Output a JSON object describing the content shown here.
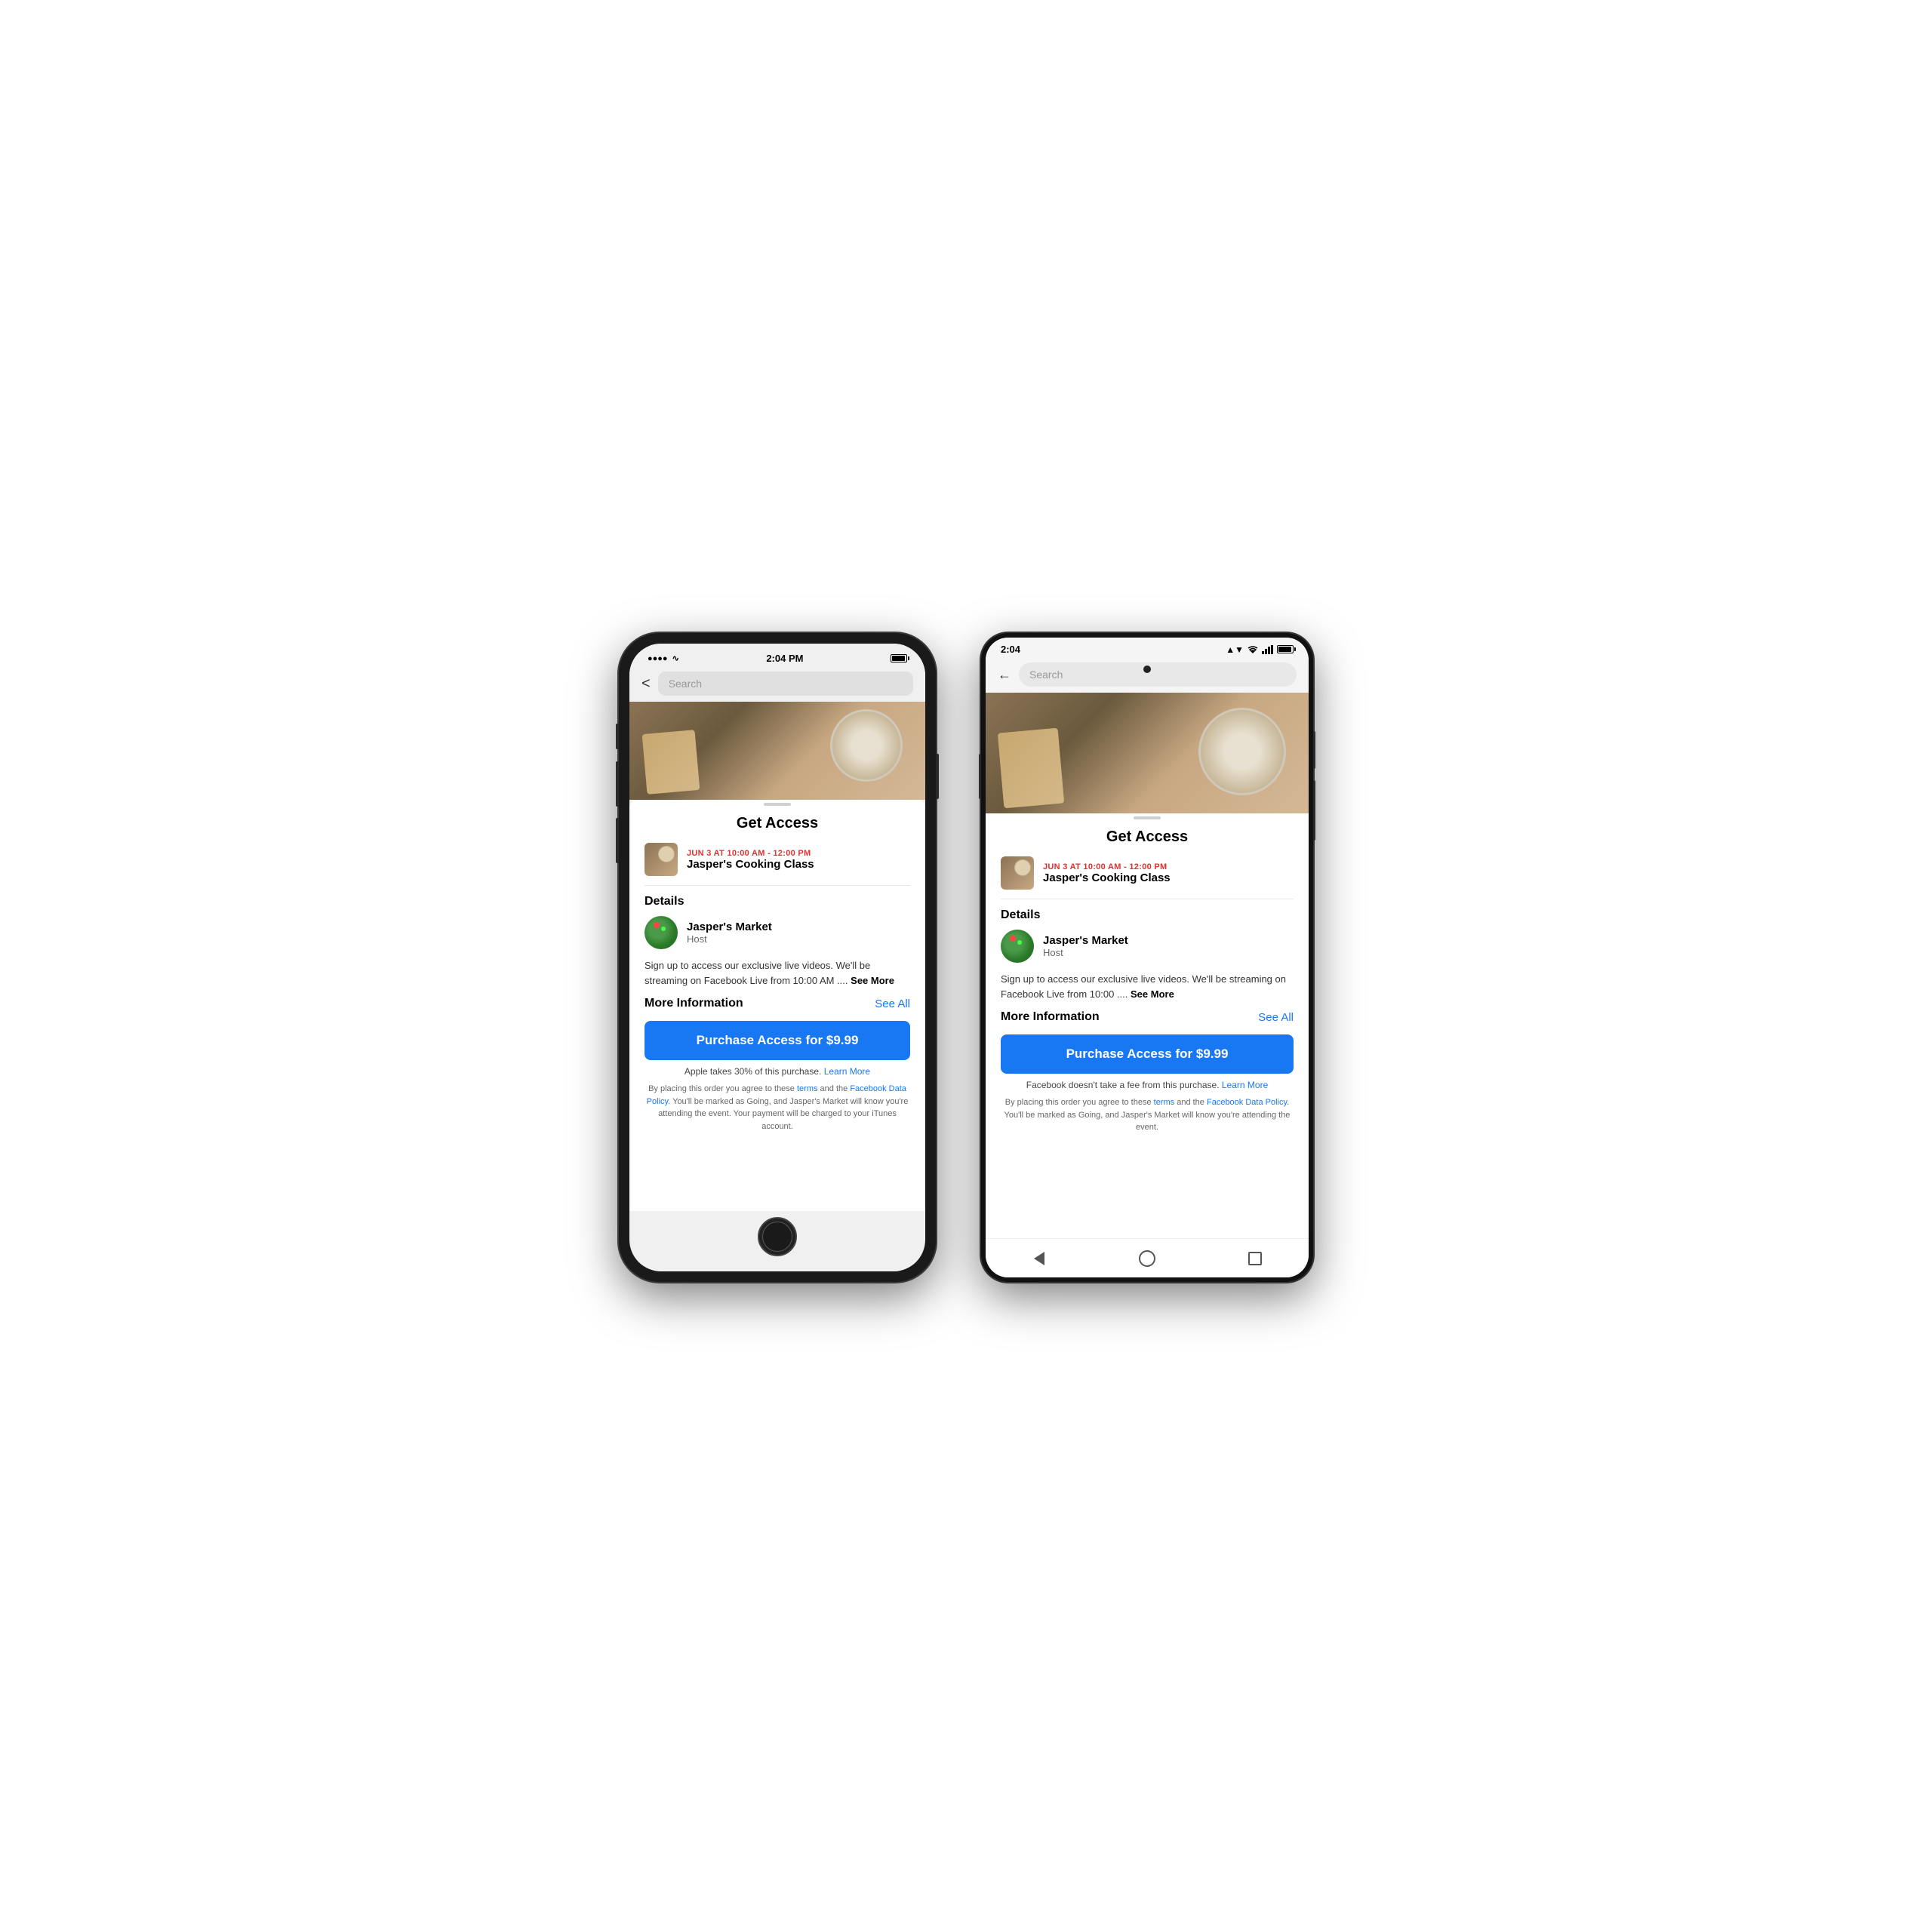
{
  "page": {
    "background": "#ffffff"
  },
  "iphone": {
    "status": {
      "signal": "●●●●",
      "wifi": "WiFi",
      "time": "2:04 PM",
      "battery": "full"
    },
    "search": {
      "back_label": "<",
      "placeholder": "Search"
    },
    "sheet": {
      "title": "Get Access",
      "event_date": "JUN 3 AT 10:00 AM - 12:00 PM",
      "event_name": "Jasper's Cooking Class",
      "details_label": "Details",
      "host_name": "Jasper's Market",
      "host_role": "Host",
      "description": "Sign up to access our exclusive live videos. We'll be streaming on Facebook Live from 10:00 AM ....",
      "see_more": "See More",
      "more_info_label": "More Information",
      "see_all_label": "See All",
      "purchase_btn": "Purchase Access for $9.99",
      "purchase_note_prefix": "Apple takes 30% of this purchase.",
      "purchase_note_link": "Learn More",
      "terms_text": "By placing this order you agree to these",
      "terms_link1": "terms",
      "terms_and": "and the",
      "terms_link2": "Facebook Data Policy",
      "terms_suffix": ". You'll be marked as Going, and Jasper's Market will know you're attending the event. Your payment will be charged to your iTunes account."
    }
  },
  "android": {
    "status": {
      "time": "2:04",
      "wifi": "▲",
      "signal": "signal",
      "battery": "full"
    },
    "search": {
      "back_label": "←",
      "placeholder": "Search"
    },
    "sheet": {
      "title": "Get Access",
      "event_date": "JUN 3 AT 10:00 AM - 12:00 PM",
      "event_name": "Jasper's Cooking Class",
      "details_label": "Details",
      "host_name": "Jasper's Market",
      "host_role": "Host",
      "description": "Sign up to access our exclusive live videos. We'll be streaming on Facebook Live from 10:00 ....",
      "see_more": "See More",
      "more_info_label": "More Information",
      "see_all_label": "See All",
      "purchase_btn": "Purchase Access for $9.99",
      "purchase_note_prefix": "Facebook doesn't take a fee from this purchase.",
      "purchase_note_link": "Learn More",
      "terms_text": "By placing this order you agree to these",
      "terms_link1": "terms",
      "terms_and": "and the",
      "terms_link2": "Facebook Data Policy",
      "terms_suffix": ". You'll be marked as Going, and Jasper's Market will know you're attending the event."
    }
  }
}
